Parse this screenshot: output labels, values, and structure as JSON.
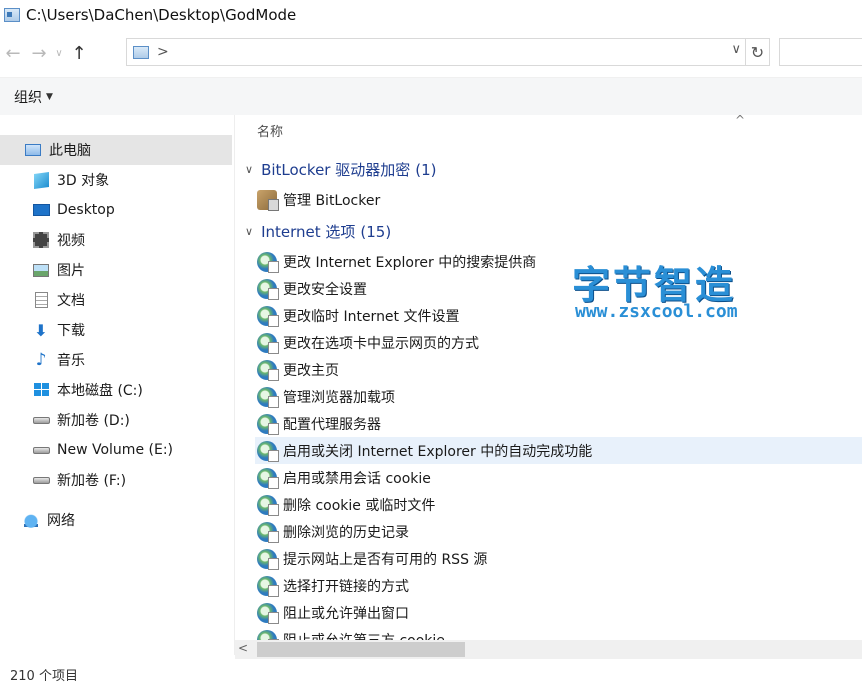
{
  "window": {
    "title": "C:\\Users\\DaChen\\Desktop\\GodMode"
  },
  "nav": {
    "back": "←",
    "forward": "→",
    "recent": "∨",
    "up": "↑",
    "address_sep": ">",
    "address_dropdown": "∨",
    "refresh": "↻"
  },
  "toolbar": {
    "organize": "组织",
    "organize_caret": "▼"
  },
  "sidebar": {
    "items": [
      {
        "label": "此电脑",
        "icon": "pc-icon"
      },
      {
        "label": "3D 对象",
        "icon": "3d-objects-icon"
      },
      {
        "label": "Desktop",
        "icon": "desktop-icon"
      },
      {
        "label": "视频",
        "icon": "video-icon"
      },
      {
        "label": "图片",
        "icon": "pictures-icon"
      },
      {
        "label": "文档",
        "icon": "documents-icon"
      },
      {
        "label": "下载",
        "icon": "download-icon"
      },
      {
        "label": "音乐",
        "icon": "music-icon"
      },
      {
        "label": "本地磁盘 (C:)",
        "icon": "windows-drive-icon"
      },
      {
        "label": "新加卷 (D:)",
        "icon": "drive-icon"
      },
      {
        "label": "New Volume (E:)",
        "icon": "drive-icon"
      },
      {
        "label": "新加卷 (F:)",
        "icon": "drive-icon"
      },
      {
        "label": "网络",
        "icon": "network-icon"
      }
    ]
  },
  "list": {
    "column_name": "名称",
    "sort_indicator": "^",
    "groups": [
      {
        "chevron": "∨",
        "name": "BitLocker 驱动器加密",
        "count": "(1)",
        "items": [
          "管理 BitLocker"
        ]
      },
      {
        "chevron": "∨",
        "name": "Internet 选项",
        "count": "(15)",
        "items": [
          "更改 Internet Explorer 中的搜索提供商",
          "更改安全设置",
          "更改临时 Internet 文件设置",
          "更改在选项卡中显示网页的方式",
          "更改主页",
          "管理浏览器加载项",
          "配置代理服务器",
          "启用或关闭 Internet Explorer 中的自动完成功能",
          "启用或禁用会话 cookie",
          "删除 cookie 或临时文件",
          "删除浏览的历史记录",
          "提示网站上是否有可用的 RSS 源",
          "选择打开链接的方式",
          "阻止或允许弹出窗口",
          "阻止或允许第三方 cookie"
        ]
      }
    ]
  },
  "watermark": {
    "title": "字节智造",
    "url": "www.zsxcool.com"
  },
  "scrollbar": {
    "left_arrow": "<"
  },
  "status": {
    "item_count": "210 个项目"
  },
  "colors": {
    "group_header": "#1e3d8f",
    "selection": "#e5e5e5",
    "hover": "#e8f1fb",
    "watermark": "#2a8fd6"
  }
}
